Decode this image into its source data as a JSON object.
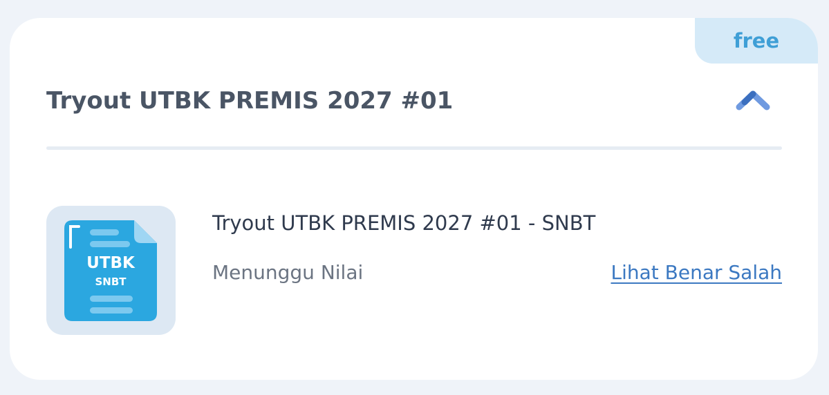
{
  "card": {
    "badge": "free",
    "title": "Tryout UTBK PREMIS 2027 #01",
    "toggle_icon": "chevron-up-icon"
  },
  "item": {
    "icon": "utbk-document-icon",
    "icon_line1": "UTBK",
    "icon_line2": "SNBT",
    "title": "Tryout UTBK PREMIS 2027 #01 - SNBT",
    "status": "Menunggu Nilai",
    "link": "Lihat Benar Salah"
  },
  "colors": {
    "badge_bg": "#d5eaf8",
    "badge_text": "#3f9fd6",
    "link": "#3b78c1",
    "doc_blue": "#2ba7e0",
    "chevron": "#6f9ae0"
  }
}
